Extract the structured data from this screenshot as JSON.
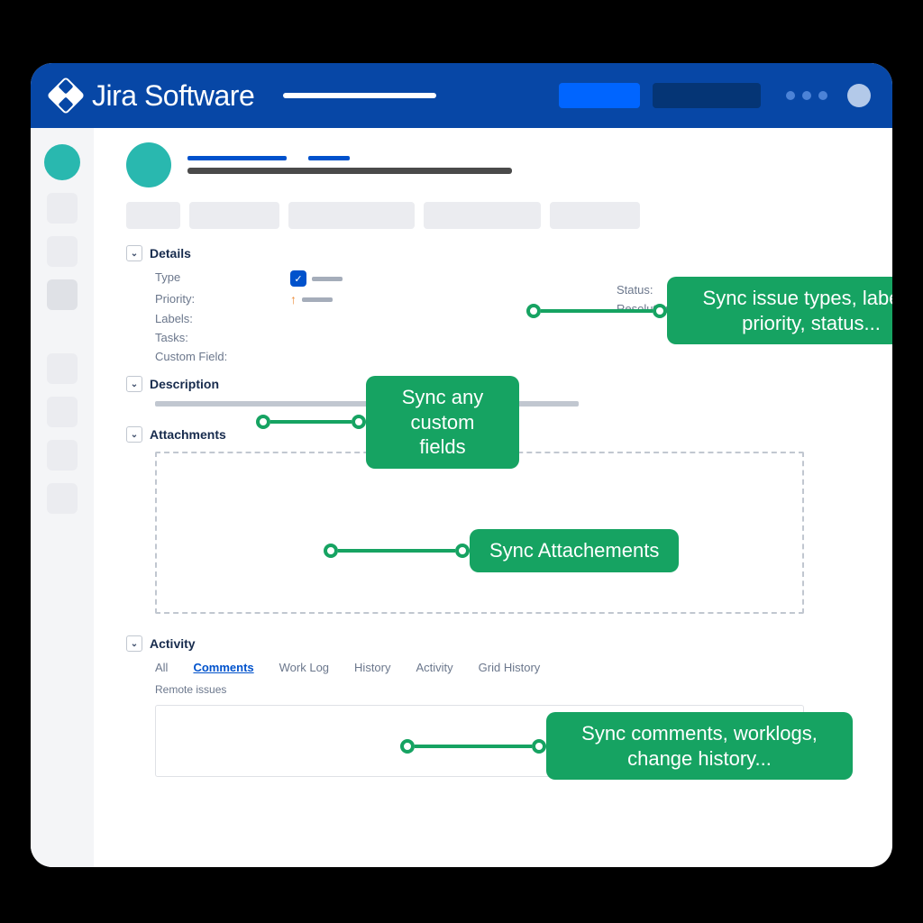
{
  "header": {
    "product_name": "Jira Software"
  },
  "sections": {
    "details_title": "Details",
    "description_title": "Description",
    "attachments_title": "Attachments",
    "activity_title": "Activity"
  },
  "details_fields": {
    "type": "Type",
    "priority": "Priority:",
    "labels": "Labels:",
    "tasks": "Tasks:",
    "custom_field": "Custom Field:",
    "status": "Status:",
    "resolution": "Resolution:"
  },
  "activity": {
    "tabs": {
      "all": "All",
      "comments": "Comments",
      "worklog": "Work Log",
      "history": "History",
      "activity": "Activity",
      "grid_history": "Grid History"
    },
    "remote_issues": "Remote issues"
  },
  "callouts": {
    "status": "Sync issue types, labels, priority, status...",
    "custom": "Sync any custom fields",
    "attachments": "Sync Attachements",
    "activity": "Sync comments, worklogs, change history..."
  }
}
